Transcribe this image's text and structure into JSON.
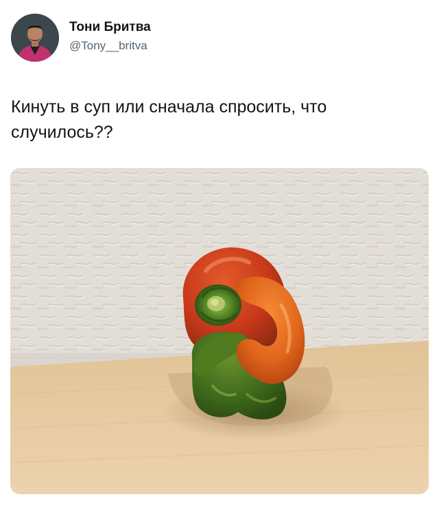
{
  "author": {
    "display_name": "Тони Бритва",
    "handle": "@Tony__britva",
    "avatar_icon": "profile-photo"
  },
  "tweet": {
    "text": "Кинуть в суп или сначала спросить, что случилось??"
  },
  "media": {
    "kind": "photo",
    "subject": "bell-pepper-hugging-itself",
    "colors": {
      "wall": "#e4e0d9",
      "table": "#e6c9a2",
      "pepper_red": "#c8391b",
      "pepper_orange": "#e0661c",
      "pepper_green": "#3f6a1c",
      "stem": "#5c8f2a"
    }
  }
}
